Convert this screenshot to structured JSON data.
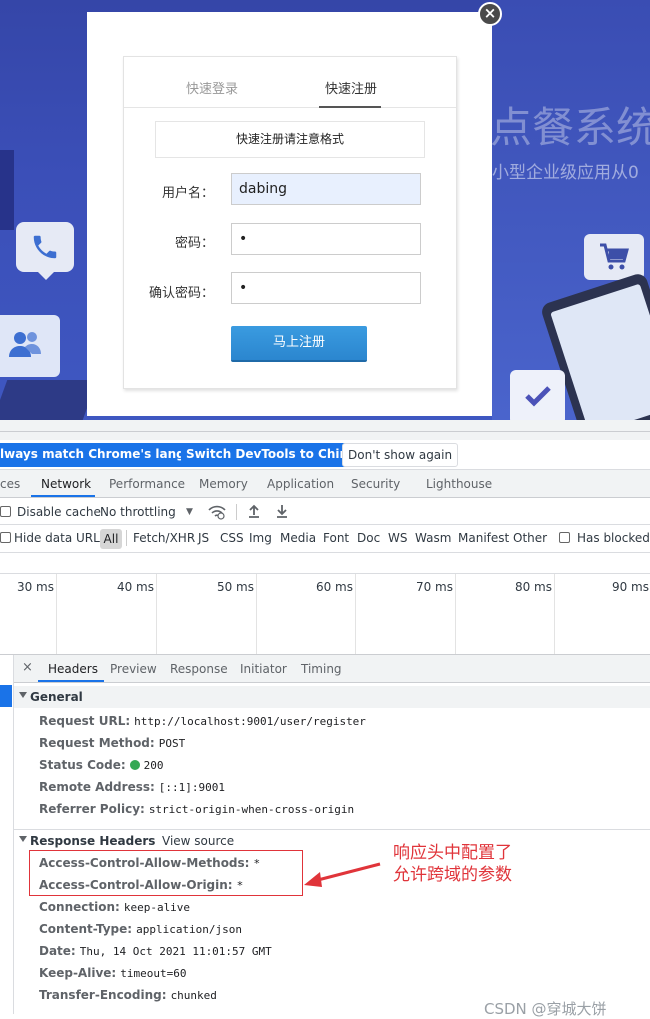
{
  "app": {
    "bg_title": "点餐系统",
    "bg_subtitle": "小型企业级应用从0",
    "modal": {
      "close_label": "×",
      "tabs": [
        "快速登录",
        "快速注册"
      ],
      "notice": "快速注册请注意格式",
      "fields": {
        "username_label": "用户名：",
        "username_value": "dabing",
        "password_label": "密码：",
        "password_value": "•",
        "confirm_label": "确认密码：",
        "confirm_value": "•"
      },
      "submit_label": "马上注册"
    }
  },
  "devtools": {
    "lang_bar": {
      "match_button": "lways match Chrome's language",
      "switch_button": "Switch DevTools to Chinese",
      "dismiss_button": "Don't show again"
    },
    "panel_tabs": [
      "ces",
      "Network",
      "Performance",
      "Memory",
      "Application",
      "Security",
      "Lighthouse"
    ],
    "toolbar": {
      "disable_cache": "Disable cache",
      "throttling": "No throttling",
      "throttle_arrow": "▼"
    },
    "filter": {
      "hide_data_urls": "Hide data URLs",
      "all": "All",
      "types": [
        "Fetch/XHR",
        "JS",
        "CSS",
        "Img",
        "Media",
        "Font",
        "Doc",
        "WS",
        "Wasm",
        "Manifest",
        "Other"
      ],
      "has_blocked": "Has blocked c"
    },
    "timeline_ticks": [
      "30 ms",
      "40 ms",
      "50 ms",
      "60 ms",
      "70 ms",
      "80 ms",
      "90 ms"
    ],
    "detail_tabs": [
      "Headers",
      "Preview",
      "Response",
      "Initiator",
      "Timing"
    ],
    "close_label": "×",
    "general": {
      "title": "General",
      "rows": [
        {
          "key": "Request URL:",
          "value": "http://localhost:9001/user/register"
        },
        {
          "key": "Request Method:",
          "value": "POST"
        },
        {
          "key": "Status Code:",
          "value": "200"
        },
        {
          "key": "Remote Address:",
          "value": "[::1]:9001"
        },
        {
          "key": "Referrer Policy:",
          "value": "strict-origin-when-cross-origin"
        }
      ]
    },
    "response_headers": {
      "title": "Response Headers",
      "view_source": "View source",
      "rows": [
        {
          "key": "Access-Control-Allow-Methods:",
          "value": "*"
        },
        {
          "key": "Access-Control-Allow-Origin:",
          "value": "*"
        },
        {
          "key": "Connection:",
          "value": "keep-alive"
        },
        {
          "key": "Content-Type:",
          "value": "application/json"
        },
        {
          "key": "Date:",
          "value": "Thu, 14 Oct 2021 11:01:57 GMT"
        },
        {
          "key": "Keep-Alive:",
          "value": "timeout=60"
        },
        {
          "key": "Transfer-Encoding:",
          "value": "chunked"
        }
      ]
    },
    "annotation": [
      "响应头中配置了",
      "允许跨域的参数"
    ],
    "watermark": "CSDN @穿城大饼",
    "colors": {
      "accent": "#1a73e8",
      "annotation": "#e0343a",
      "status_ok": "#34a853"
    }
  }
}
